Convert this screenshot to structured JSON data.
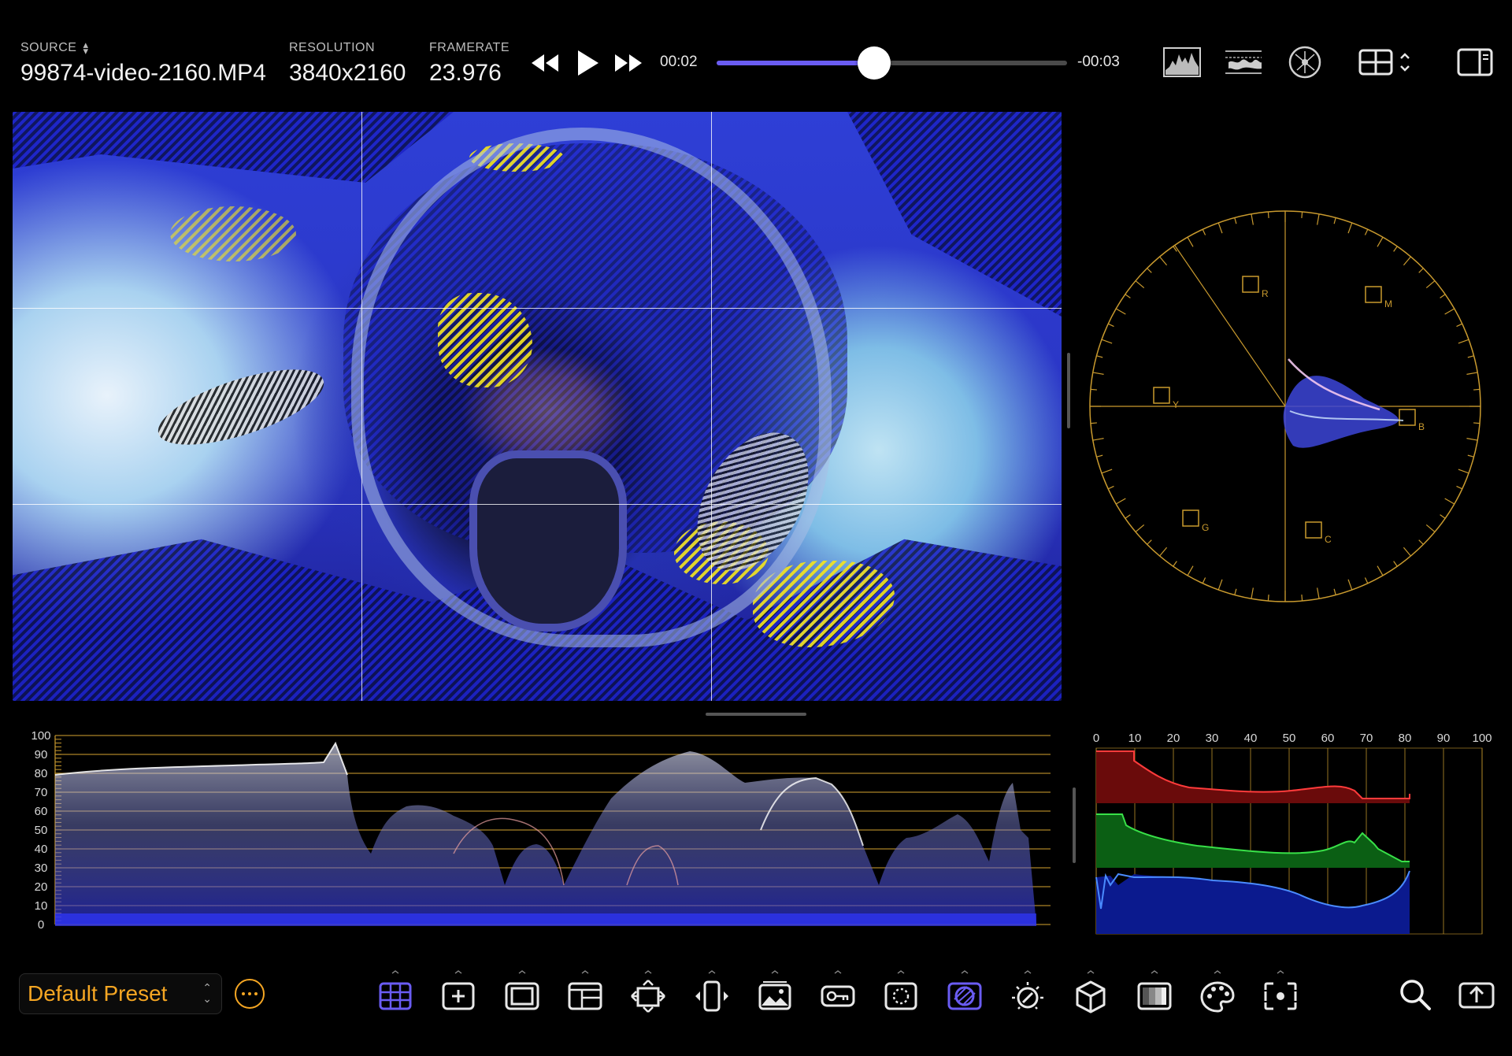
{
  "header": {
    "source_label": "SOURCE",
    "source_value": "99874-video-2160.MP4",
    "resolution_label": "RESOLUTION",
    "resolution_value": "3840x2160",
    "framerate_label": "FRAMERATE",
    "framerate_value": "23.976"
  },
  "transport": {
    "elapsed": "00:02",
    "remaining": "-00:03",
    "progress": 0.45
  },
  "colors": {
    "accent": "#6a5cf2",
    "preset_orange": "#f5a623",
    "scope_grid": "#c99a2e"
  },
  "top_icons": [
    "histogram-icon",
    "waveform-icon",
    "vectorscope-icon",
    "layout-grid-icon",
    "sidebar-toggle-icon"
  ],
  "waveform": {
    "scale": [
      "100",
      "90",
      "80",
      "70",
      "60",
      "50",
      "40",
      "30",
      "20",
      "10",
      "0"
    ]
  },
  "histogram": {
    "scale": [
      "0",
      "10",
      "20",
      "30",
      "40",
      "50",
      "60",
      "70",
      "80",
      "90",
      "100"
    ]
  },
  "vectorscope": {
    "targets": [
      "R",
      "M",
      "Y",
      "B",
      "G",
      "C"
    ]
  },
  "bottom": {
    "preset_name": "Default Preset",
    "tools": [
      "grid-overlay-icon",
      "add-overlay-icon",
      "safe-area-icon",
      "frame-layout-icon",
      "transform-icon",
      "split-view-icon",
      "image-overlay-icon",
      "key-icon",
      "mask-icon",
      "false-color-icon",
      "exposure-icon",
      "lut-cube-icon",
      "gradient-icon",
      "palette-icon",
      "focus-peaking-icon"
    ],
    "active_tools": [
      "grid-overlay-icon",
      "false-color-icon"
    ]
  }
}
